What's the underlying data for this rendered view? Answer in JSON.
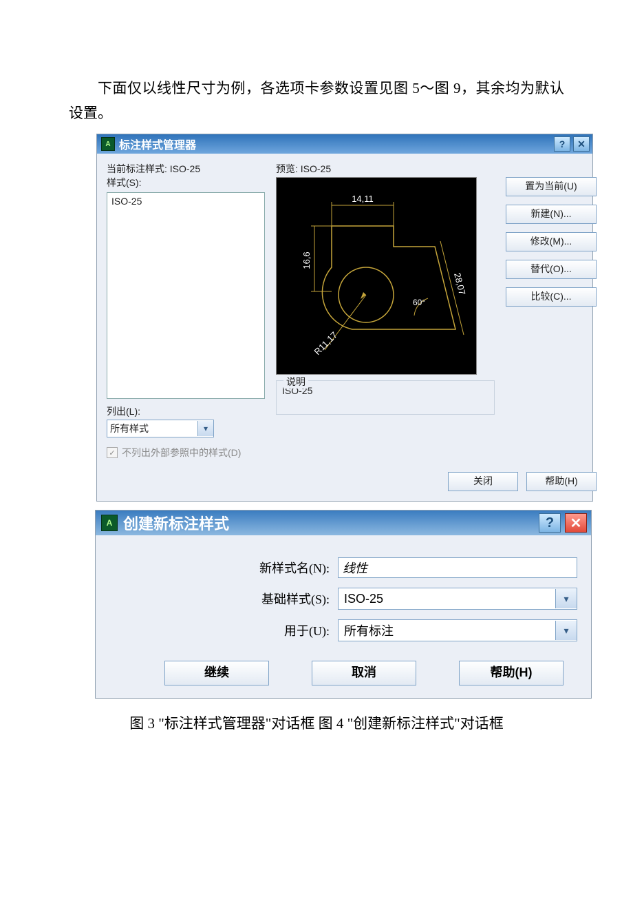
{
  "intro_text": "下面仅以线性尺寸为例，各选项卡参数设置见图 5～图 9，其余均为默认设置。",
  "dlg1": {
    "title": "标注样式管理器",
    "current_style_label": "当前标注样式:",
    "current_style_value": "ISO-25",
    "styles_label": "样式(S):",
    "style_item": "ISO-25",
    "preview_label": "预览:",
    "preview_value": "ISO-25",
    "dims": {
      "top": "14,11",
      "left": "16,6",
      "diag": "28,07",
      "angle": "60°",
      "radius": "R11,17"
    },
    "btns": {
      "set_current": "置为当前(U)",
      "new": "新建(N)...",
      "modify": "修改(M)...",
      "override": "替代(O)...",
      "compare": "比较(C)..."
    },
    "list_label": "列出(L):",
    "list_value": "所有样式",
    "chk_label": "不列出外部参照中的样式(D)",
    "desc_legend": "说明",
    "desc_text": "ISO-25",
    "close": "关闭",
    "help": "帮助(H)"
  },
  "dlg2": {
    "title": "创建新标注样式",
    "row_name": "新样式名(N):",
    "name_value": "线性",
    "row_base": "基础样式(S):",
    "base_value": "ISO-25",
    "row_use": "用于(U):",
    "use_value": "所有标注",
    "continue": "继续",
    "cancel": "取消",
    "help": "帮助(H)"
  },
  "caption": "图 3 \"标注样式管理器\"对话框  图 4 \"创建新标注样式\"对话框"
}
